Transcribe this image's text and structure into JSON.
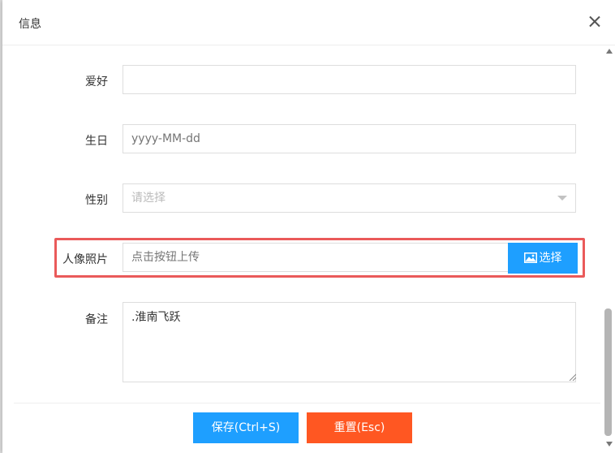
{
  "dialog": {
    "title": "信息"
  },
  "form": {
    "hobby": {
      "label": "爱好",
      "value": ""
    },
    "birthday": {
      "label": "生日",
      "placeholder": "yyyy-MM-dd"
    },
    "gender": {
      "label": "性别",
      "placeholder": "请选择"
    },
    "photo": {
      "label": "人像照片",
      "placeholder": "点击按钮上传",
      "button": "选择"
    },
    "remark": {
      "label": "备注",
      "value": ".淮南飞跃"
    }
  },
  "footer": {
    "save": "保存(Ctrl+S)",
    "reset": "重置(Esc)"
  },
  "colors": {
    "primary": "#1e9fff",
    "danger": "#ff5722",
    "highlight": "#ea5a5a"
  },
  "icons": {
    "close": "close-icon",
    "image": "image-icon",
    "dropdown": "chevron-down-icon"
  }
}
